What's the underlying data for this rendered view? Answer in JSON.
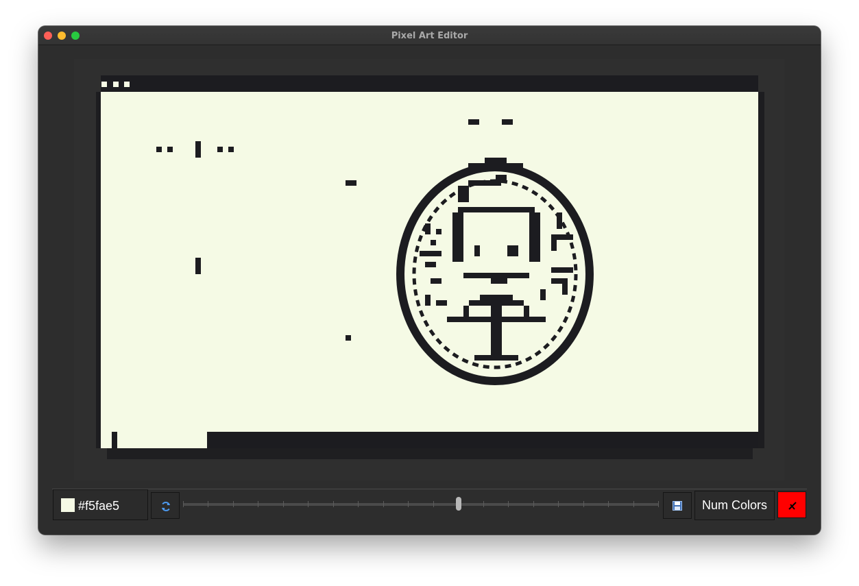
{
  "window": {
    "title": "Pixel Art Editor"
  },
  "toolbar": {
    "current_color_label": "#f5fae5",
    "current_color": "#f5fae5",
    "refresh_icon": "refresh-icon",
    "save_icon": "floppy-disk-icon",
    "num_colors_label": "Num Colors",
    "close_icon": "close-icon",
    "close_color": "#ff0000",
    "slider": {
      "value": 0.58,
      "ticks": 20
    }
  },
  "canvas": {
    "background": "#f5fae5",
    "foreground": "#1c1c20",
    "image_titlebar_dots": 3
  }
}
